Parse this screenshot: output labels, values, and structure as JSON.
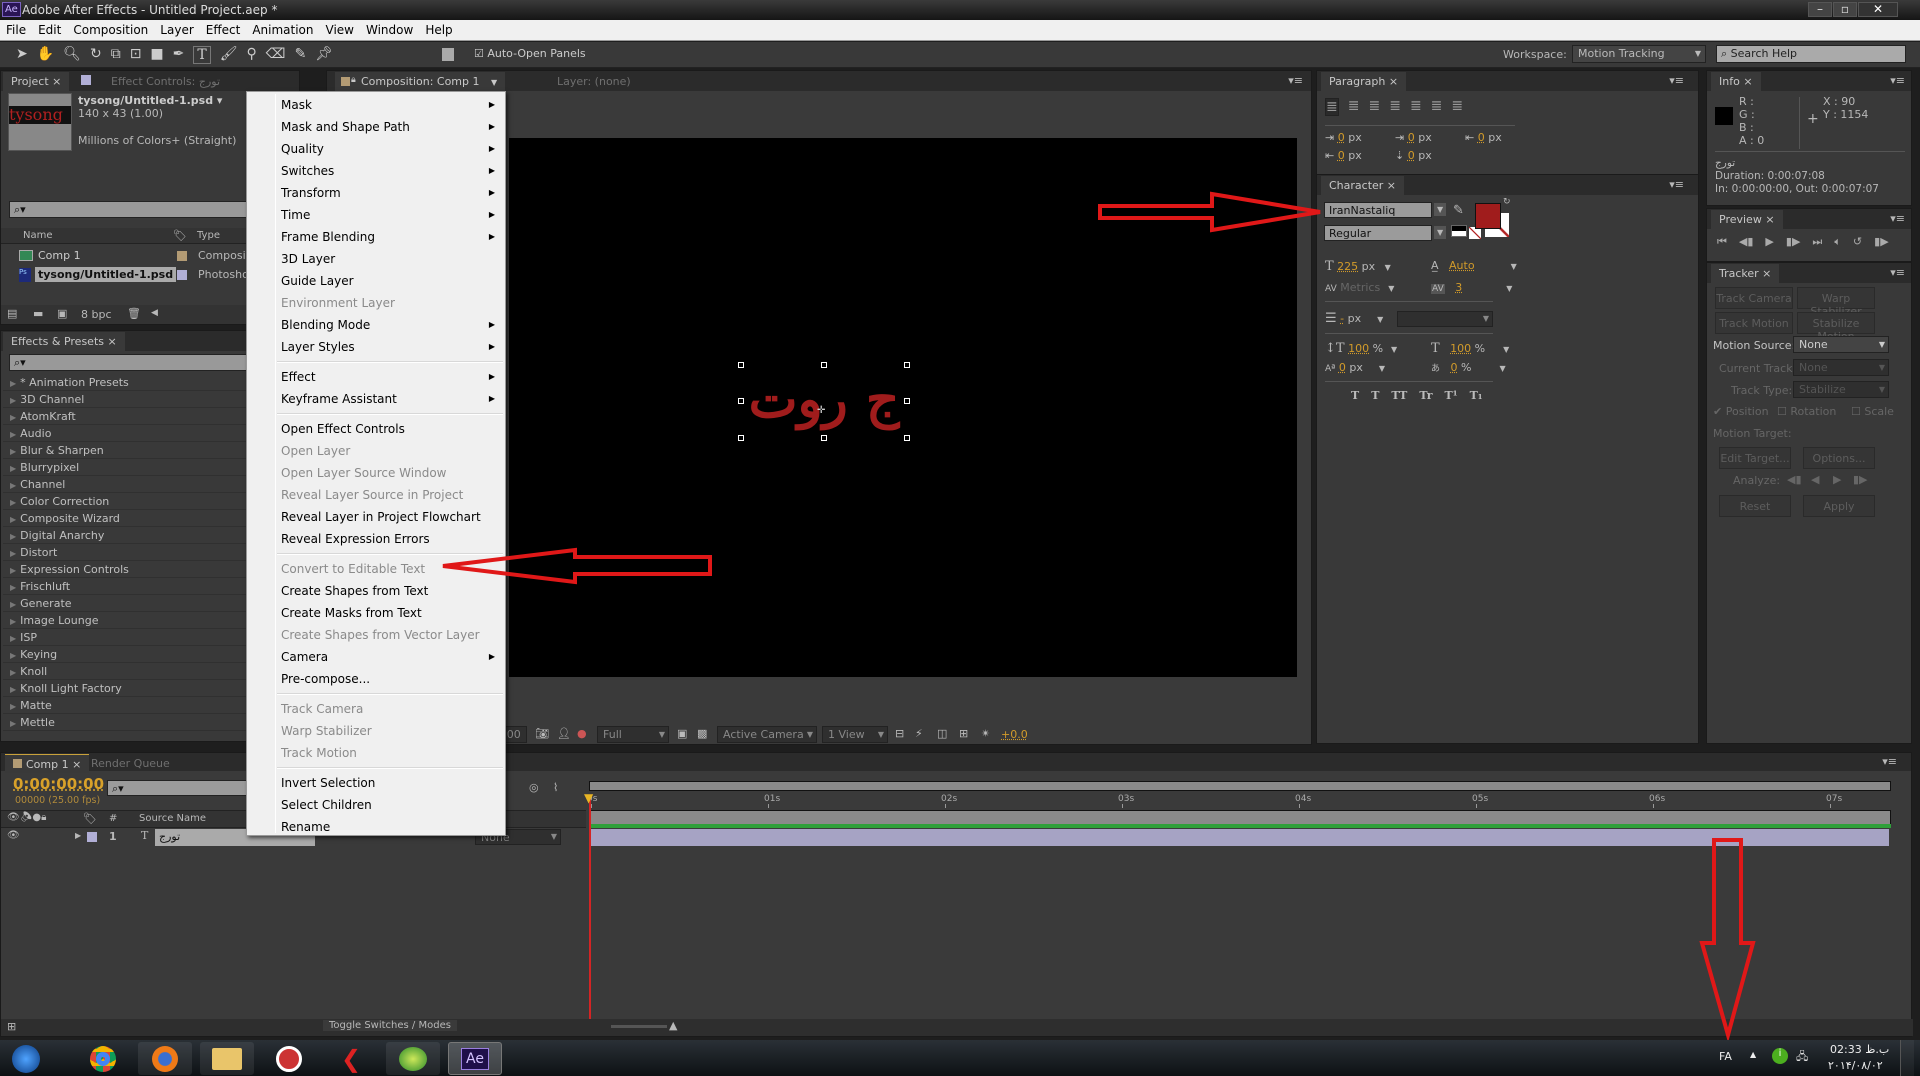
{
  "app": {
    "title": "Adobe After Effects - Untitled Project.aep *",
    "logo": "Ae"
  },
  "menubar": [
    "File",
    "Edit",
    "Composition",
    "Layer",
    "Effect",
    "Animation",
    "View",
    "Window",
    "Help"
  ],
  "toolbar": {
    "auto_open_panels": "Auto-Open Panels",
    "auto_open_checked": true,
    "workspace_label": "Workspace:",
    "workspace_value": "Motion Tracking",
    "search_placeholder": "Search Help"
  },
  "project": {
    "tab": "Project",
    "effect_controls_tab": "Effect Controls: تورج",
    "thumb_text": "tysong",
    "item_name": "tysong/Untitled-1.psd ▾",
    "item_size": "140 x 43 (1.00)",
    "item_colors": "Millions of Colors+ (Straight)",
    "col_name": "Name",
    "col_type": "Type",
    "rows": [
      {
        "name": "Comp 1",
        "type": "Composi...",
        "color": "#b39b74"
      },
      {
        "name": "tysong/Untitled-1.psd",
        "type": "Photosho...",
        "color": "#b1afd6"
      }
    ],
    "bpc": "8 bpc"
  },
  "effects": {
    "tab": "Effects & Presets",
    "items": [
      "* Animation Presets",
      "3D Channel",
      "AtomKraft",
      "Audio",
      "Blur & Sharpen",
      "Blurrypixel",
      "Channel",
      "Color Correction",
      "Composite Wizard",
      "Digital Anarchy",
      "Distort",
      "Expression Controls",
      "Frischluft",
      "Generate",
      "Image Lounge",
      "ISP",
      "Keying",
      "Knoll",
      "Knoll Light Factory",
      "Matte",
      "Mettle"
    ]
  },
  "composition": {
    "tab": "Composition: Comp 1",
    "layer_tab": "Layer: (none)",
    "canvas_text": "ج روت",
    "text_color": "#a01c1c",
    "viewer_bar": {
      "time": ":00",
      "resolution": "Full",
      "camera": "Active Camera",
      "views": "1 View",
      "exposure": "+0.0"
    }
  },
  "context_menu": [
    {
      "label": "Mask",
      "submenu": true
    },
    {
      "label": "Mask and Shape Path",
      "submenu": true
    },
    {
      "label": "Quality",
      "submenu": true
    },
    {
      "label": "Switches",
      "submenu": true
    },
    {
      "label": "Transform",
      "submenu": true
    },
    {
      "label": "Time",
      "submenu": true
    },
    {
      "label": "Frame Blending",
      "submenu": true
    },
    {
      "label": "3D Layer"
    },
    {
      "label": "Guide Layer"
    },
    {
      "label": "Environment Layer",
      "disabled": true
    },
    {
      "label": "Blending Mode",
      "submenu": true
    },
    {
      "label": "Layer Styles",
      "submenu": true
    },
    {
      "separator": true
    },
    {
      "label": "Effect",
      "submenu": true
    },
    {
      "label": "Keyframe Assistant",
      "submenu": true
    },
    {
      "separator": true
    },
    {
      "label": "Open Effect Controls"
    },
    {
      "label": "Open Layer",
      "disabled": true
    },
    {
      "label": "Open Layer Source Window",
      "disabled": true
    },
    {
      "label": "Reveal Layer Source in Project",
      "disabled": true
    },
    {
      "label": "Reveal Layer in Project Flowchart"
    },
    {
      "label": "Reveal Expression Errors"
    },
    {
      "separator": true
    },
    {
      "label": "Convert to Editable Text",
      "disabled": true
    },
    {
      "label": "Create Shapes from Text"
    },
    {
      "label": "Create Masks from Text"
    },
    {
      "label": "Create Shapes from Vector Layer",
      "disabled": true
    },
    {
      "label": "Camera",
      "submenu": true
    },
    {
      "label": "Pre-compose..."
    },
    {
      "separator": true
    },
    {
      "label": "Track Camera",
      "disabled": true
    },
    {
      "label": "Warp Stabilizer",
      "disabled": true
    },
    {
      "label": "Track Motion",
      "disabled": true
    },
    {
      "separator": true
    },
    {
      "label": "Invert Selection"
    },
    {
      "label": "Select Children"
    },
    {
      "label": "Rename"
    }
  ],
  "paragraph": {
    "tab": "Paragraph",
    "indent_left": "0",
    "indent_first": "0",
    "indent_right": "0",
    "space_before": "0",
    "space_after": "0",
    "unit": "px"
  },
  "character": {
    "tab": "Character",
    "font": "IranNastaliq",
    "style": "Regular",
    "fill_color": "#a01c1c",
    "size": "225",
    "leading": "Auto",
    "kerning": "Metrics",
    "tracking": "3",
    "stroke_width": "-",
    "v_scale": "100",
    "h_scale": "100",
    "baseline": "0",
    "tsume": "0",
    "px": "px",
    "pct": "%",
    "styles": [
      "T",
      "T",
      "TT",
      "Tr",
      "T¹",
      "T₁"
    ]
  },
  "info": {
    "tab": "Info",
    "r": "R :",
    "g": "G :",
    "b": "B :",
    "a": "A : 0",
    "x": "X : 90",
    "y": "Y : 1154",
    "layer": "تورج",
    "duration": "Duration: 0:00:07:08",
    "inout": "In: 0:00:00:00, Out: 0:00:07:07"
  },
  "preview": {
    "tab": "Preview"
  },
  "tracker": {
    "tab": "Tracker",
    "track_camera": "Track Camera",
    "warp_stabilizer": "Warp Stabilizer",
    "track_motion": "Track Motion",
    "stabilize_motion": "Stabilize Motion",
    "motion_source_label": "Motion Source:",
    "motion_source": "None",
    "current_track_label": "Current Track:",
    "current_track": "None",
    "track_type_label": "Track Type:",
    "track_type": "Stabilize",
    "position": "Position",
    "rotation": "Rotation",
    "scale": "Scale",
    "motion_target": "Motion Target:",
    "edit_target": "Edit Target...",
    "options": "Options...",
    "analyze": "Analyze:",
    "reset": "Reset",
    "apply": "Apply"
  },
  "timeline": {
    "tab": "Comp 1",
    "render_queue_tab": "Render Queue",
    "timecode": "0:00:00:00",
    "fps": "00000 (25.00 fps)",
    "col_source": "Source Name",
    "col_num": "#",
    "layer_num": "1",
    "layer_name": "تورج",
    "parent": "None",
    "ticks": [
      "0s",
      "01s",
      "02s",
      "03s",
      "04s",
      "05s",
      "06s",
      "07s"
    ],
    "toggle": "Toggle Switches / Modes"
  },
  "taskbar": {
    "lang": "FA",
    "time": "02:33 ب.ظ",
    "date": "۲۰۱۴/۰۸/۰۲",
    "apps": [
      "windows-start",
      "chrome",
      "firefox",
      "explorer",
      "ccleaner",
      "flash",
      "greenapp",
      "after-effects"
    ]
  }
}
